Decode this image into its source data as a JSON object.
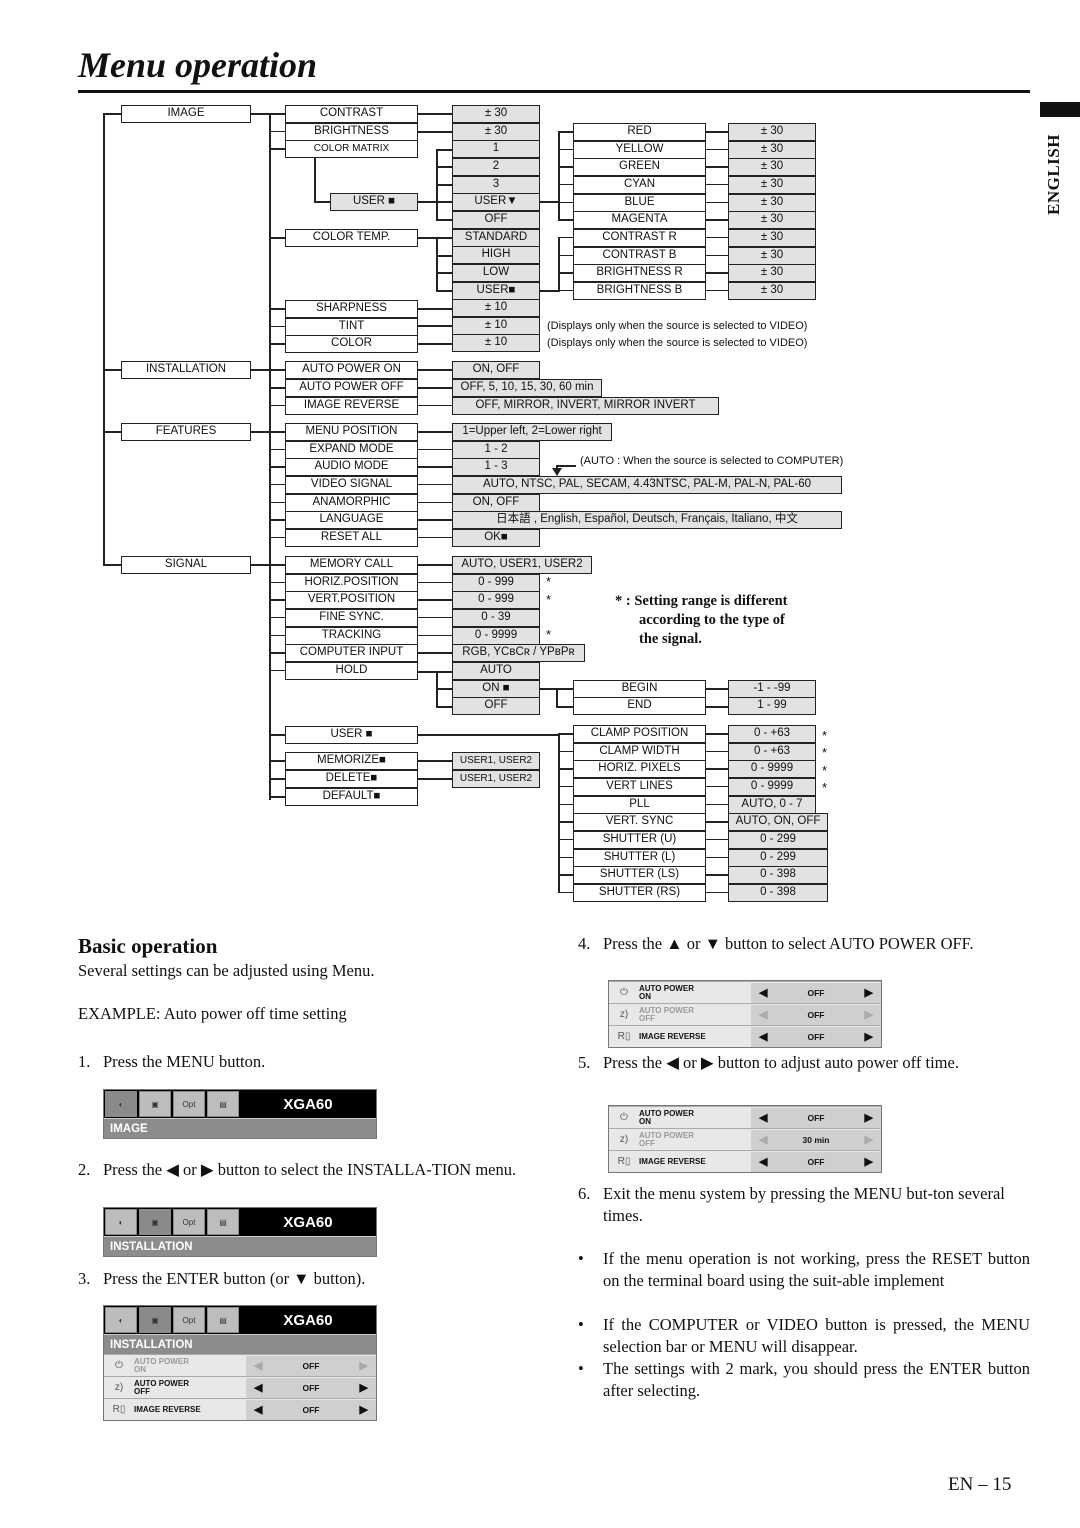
{
  "page": {
    "title": "Menu operation",
    "language_tab": "ENGLISH",
    "page_number": "EN – 15"
  },
  "tree": {
    "level1": [
      "IMAGE",
      "INSTALLATION",
      "FEATURES",
      "SIGNAL"
    ],
    "image": {
      "items": [
        "CONTRAST",
        "BRIGHTNESS",
        "COLOR MATRIX",
        "USER ■",
        "COLOR TEMP.",
        "SHARPNESS",
        "TINT",
        "COLOR"
      ],
      "values": [
        "± 30",
        "± 30",
        "1",
        "2",
        "3",
        "USER▼",
        "OFF",
        "STANDARD",
        "HIGH",
        "LOW",
        "USER■",
        "± 10",
        "± 10",
        "± 10"
      ],
      "color_matrix_user_items": [
        "RED",
        "YELLOW",
        "GREEN",
        "CYAN",
        "BLUE",
        "MAGENTA"
      ],
      "color_temp_user_items": [
        "CONTRAST R",
        "CONTRAST B",
        "BRIGHTNESS R",
        "BRIGHTNESS B"
      ],
      "user_item_values": [
        "± 30",
        "± 30",
        "± 30",
        "± 30",
        "± 30",
        "± 30",
        "± 30",
        "± 30",
        "± 30",
        "± 30"
      ],
      "notes": [
        "(Displays only when the source is selected to VIDEO)",
        "(Displays only when the source is selected to VIDEO)"
      ]
    },
    "installation": {
      "items": [
        "AUTO POWER ON",
        "AUTO POWER OFF",
        "IMAGE REVERSE"
      ],
      "values": [
        "ON, OFF",
        "OFF, 5, 10, 15, 30, 60 min",
        "OFF, MIRROR, INVERT, MIRROR INVERT"
      ]
    },
    "features": {
      "items": [
        "MENU POSITION",
        "EXPAND MODE",
        "AUDIO MODE",
        "VIDEO SIGNAL",
        "ANAMORPHIC",
        "LANGUAGE",
        "RESET ALL"
      ],
      "values": [
        "1=Upper left, 2=Lower right",
        "1 - 2",
        "1 - 3",
        "AUTO, NTSC, PAL, SECAM, 4.43NTSC, PAL-M, PAL-N, PAL-60",
        "ON, OFF",
        "日本語 , English, Español, Deutsch, Français, Italiano, 中文",
        "OK■"
      ],
      "note": "(AUTO : When the source is selected to COMPUTER)"
    },
    "signal": {
      "items": [
        "MEMORY CALL",
        "HORIZ.POSITION",
        "VERT.POSITION",
        "FINE SYNC.",
        "TRACKING",
        "COMPUTER INPUT",
        "HOLD",
        "USER ■",
        "MEMORIZE■",
        "DELETE■",
        "DEFAULT■"
      ],
      "values": [
        "AUTO, USER1, USER2",
        "0 - 999",
        "0 - 999",
        "0 - 39",
        "0 - 9999",
        "RGB, YCʙCʀ / YPʙPʀ",
        "AUTO",
        "ON ■",
        "OFF"
      ],
      "memorize_values": [
        "USER1, USER2",
        "USER1, USER2"
      ],
      "hold_items": [
        "BEGIN",
        "END"
      ],
      "hold_values": [
        "-1 - -99",
        "1 - 99"
      ],
      "user_items": [
        "CLAMP POSITION",
        "CLAMP WIDTH",
        "HORIZ. PIXELS",
        "VERT LINES",
        "PLL",
        "VERT. SYNC",
        "SHUTTER (U)",
        "SHUTTER (L)",
        "SHUTTER (LS)",
        "SHUTTER (RS)"
      ],
      "user_values": [
        "0 - +63",
        "0 - +63",
        "0 - 9999",
        "0 - 9999",
        "AUTO, 0 - 7",
        "AUTO, ON, OFF",
        "0 - 299",
        "0 - 299",
        "0 - 398",
        "0 - 398"
      ],
      "star": "*",
      "footnote": [
        "* : Setting range is different",
        "according to the type of",
        "the signal."
      ]
    }
  },
  "basic": {
    "heading": "Basic operation",
    "intro": "Several settings can be adjusted using Menu.",
    "example": "EXAMPLE: Auto power off time setting",
    "steps": [
      {
        "num": "1.",
        "text": "Press the MENU button."
      },
      {
        "num": "2.",
        "text": "Press the ◀ or ▶ button to select the INSTALLA-TION menu."
      },
      {
        "num": "3.",
        "text": "Press the ENTER button (or ▼ button)."
      },
      {
        "num": "4.",
        "text": "Press the ▲ or ▼ button to select AUTO POWER OFF."
      },
      {
        "num": "5.",
        "text": "Press the ◀ or ▶ button to adjust auto power off time."
      },
      {
        "num": "6.",
        "text": "Exit the menu system by pressing the MENU but-ton several times."
      }
    ],
    "bullets": [
      "If the menu operation is not working, press the RESET button on the terminal board using the suit-able implement",
      "If the COMPUTER or VIDEO button is pressed, the MENU selection bar or MENU will disappear.",
      "The settings with 2  mark, you should press the ENTER button after selecting."
    ]
  },
  "osd": {
    "model": "XGA60",
    "icons": [
      "image-icon",
      "installation-icon",
      "features-icon",
      "signal-icon"
    ],
    "icon_text": [
      "◐",
      "▣",
      "Opt",
      "▤"
    ],
    "category_image": "IMAGE",
    "category_installation": "INSTALLATION",
    "rows": [
      "AUTO POWER ON",
      "AUTO POWER OFF",
      "IMAGE REVERSE"
    ],
    "row_labels": [
      [
        "AUTO POWER",
        "ON"
      ],
      [
        "AUTO POWER",
        "OFF"
      ],
      [
        "IMAGE REVERSE",
        ""
      ]
    ],
    "row_icons": [
      "⏻",
      "z)",
      "R▯"
    ],
    "left_arrow": "◀",
    "right_arrow": "▶",
    "screen3_values": [
      "OFF",
      "OFF",
      "OFF"
    ],
    "screen4_values": [
      "OFF",
      "OFF",
      "OFF"
    ],
    "screen5_values": [
      "OFF",
      "30 min",
      "OFF"
    ]
  }
}
